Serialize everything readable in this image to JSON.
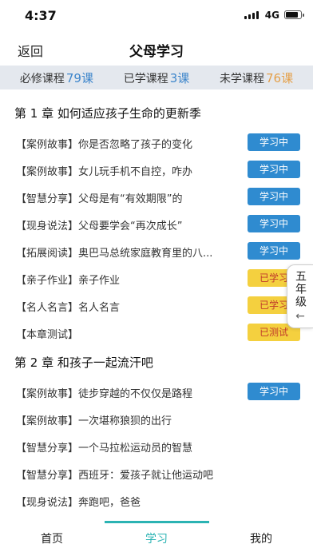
{
  "status": {
    "time": "4:37",
    "network": "4G"
  },
  "nav": {
    "back": "返回",
    "title": "父母学习"
  },
  "summary": {
    "required_label": "必修课程",
    "required_count": "79课",
    "learned_label": "已学课程",
    "learned_count": "3课",
    "unlearned_label": "未学课程",
    "unlearned_count": "76课"
  },
  "chapters": [
    {
      "title": "第 1 章 如何适应孩子生命的更新季",
      "lessons": [
        {
          "text": "【案例故事】你是否忽略了孩子的变化",
          "badge": "学习中",
          "type": "learning"
        },
        {
          "text": "【案例故事】女儿玩手机不自控，咋办",
          "badge": "学习中",
          "type": "learning"
        },
        {
          "text": "【智慧分享】父母是有“有效期限”的",
          "badge": "学习中",
          "type": "learning"
        },
        {
          "text": "【现身说法】父母要学会“再次成长”",
          "badge": "学习中",
          "type": "learning"
        },
        {
          "text": "【拓展阅读】奥巴马总统家庭教育里的八...",
          "badge": "学习中",
          "type": "learning"
        },
        {
          "text": "【亲子作业】亲子作业",
          "badge": "已学习",
          "type": "learned"
        },
        {
          "text": "【名人名言】名人名言",
          "badge": "已学习",
          "type": "learned"
        },
        {
          "text": "【本章测试】",
          "badge": "已测试",
          "type": "tested"
        }
      ]
    },
    {
      "title": "第 2 章 和孩子一起流汗吧",
      "lessons": [
        {
          "text": "【案例故事】徒步穿越的不仅仅是路程",
          "badge": "学习中",
          "type": "learning"
        },
        {
          "text": "【案例故事】一次堪称狼狈的出行",
          "badge": "",
          "type": ""
        },
        {
          "text": "【智慧分享】一个马拉松运动员的智慧",
          "badge": "",
          "type": ""
        },
        {
          "text": "【智慧分享】西班牙：爱孩子就让他运动吧",
          "badge": "",
          "type": ""
        },
        {
          "text": "【现身说法】奔跑吧，爸爸",
          "badge": "",
          "type": ""
        }
      ]
    }
  ],
  "grade_tab": {
    "label": "五年级",
    "arrow": "←"
  },
  "tabs": {
    "home": "首页",
    "study": "学习",
    "mine": "我的"
  },
  "colors": {
    "accent_blue": "#3e86cb",
    "accent_orange": "#e4a04a",
    "tab_active": "#2bb3b3",
    "badge_blue": "#2f8bd0",
    "badge_yellow": "#f4d03f"
  }
}
